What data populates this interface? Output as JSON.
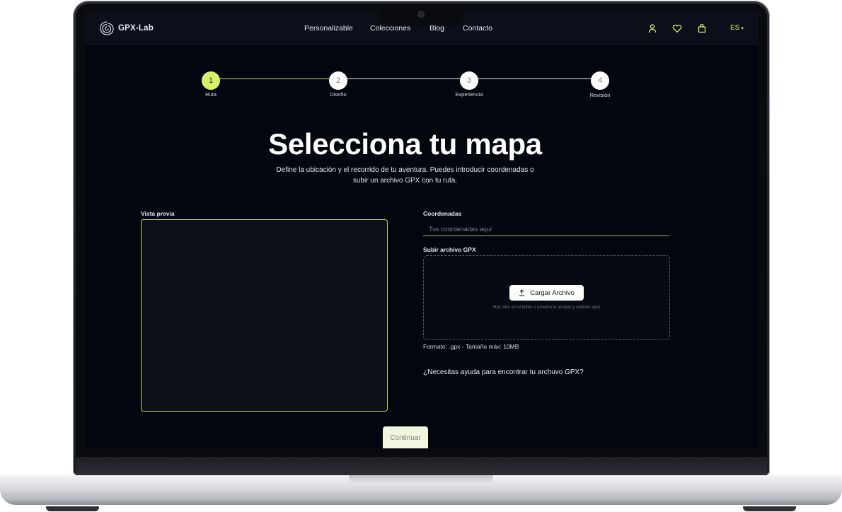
{
  "brand": {
    "name": "GPX-Lab"
  },
  "nav": {
    "links": [
      "Personalizable",
      "Colecciones",
      "Blog",
      "Contacto"
    ],
    "icons": [
      "user-icon",
      "heart-icon",
      "bag-icon"
    ],
    "language": "ES"
  },
  "stepper": {
    "steps": [
      {
        "number": "1",
        "label": "Ruta"
      },
      {
        "number": "2",
        "label": "Diseño"
      },
      {
        "number": "3",
        "label": "Experiencia"
      },
      {
        "number": "4",
        "label": "Revisión"
      }
    ],
    "current_step": 1
  },
  "main": {
    "title": "Selecciona tu mapa",
    "subtitle_line1": "Define la ubicación y el recorrido de tu aventura. Puedes introducir coordenadas o",
    "subtitle_line2": "subir un archivo GPX con tu ruta."
  },
  "preview": {
    "label": "Vista previa"
  },
  "coordinates": {
    "label": "Coordenadas",
    "placeholder": "Tus coordenadas aquí",
    "value": ""
  },
  "upload": {
    "label": "Subir archivo GPX",
    "button": "Cargar Archivo",
    "hint": "Haz click en el botón o arrastra tu archivo y suéltalo aquí",
    "format": "Formato: .gpx - Tamaño máx: 10MB"
  },
  "help_link": "¿Necesitas ayuda para encontrar tu archuvo GPX?",
  "continue_button": "Continuar",
  "colors": {
    "accent": "#d6f26a",
    "background": "#03060f",
    "navbar": "#0c0f1a"
  }
}
